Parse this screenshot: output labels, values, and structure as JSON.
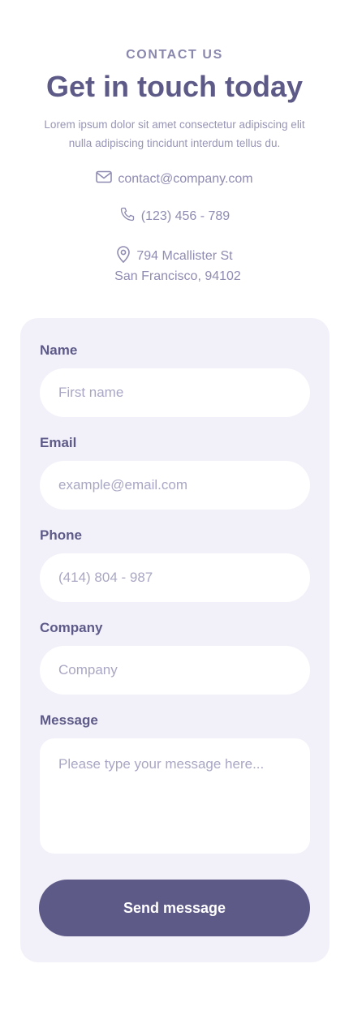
{
  "header": {
    "eyebrow": "CONTACT US",
    "title": "Get in touch today",
    "description_line1": "Lorem ipsum dolor sit amet consectetur adipiscing elit",
    "description_line2": "nulla adipiscing tincidunt interdum tellus du."
  },
  "contact": {
    "email": "contact@company.com",
    "phone": "(123) 456 - 789",
    "address_line1": "794 Mcallister St",
    "address_line2": "San Francisco, 94102",
    "icons": [
      "mail-icon",
      "phone-icon",
      "location-pin-icon"
    ]
  },
  "form": {
    "name": {
      "label": "Name",
      "placeholder": "First name"
    },
    "email": {
      "label": "Email",
      "placeholder": "example@email.com"
    },
    "phone": {
      "label": "Phone",
      "placeholder": "(414) 804 - 987"
    },
    "company": {
      "label": "Company",
      "placeholder": "Company"
    },
    "message": {
      "label": "Message",
      "placeholder": "Please type your message here..."
    },
    "submit_label": "Send message"
  },
  "colors": {
    "accent": "#5d5a88",
    "card_background": "#f2f1fa",
    "muted_text": "#8f8cb2",
    "placeholder": "#a9a7c4"
  }
}
